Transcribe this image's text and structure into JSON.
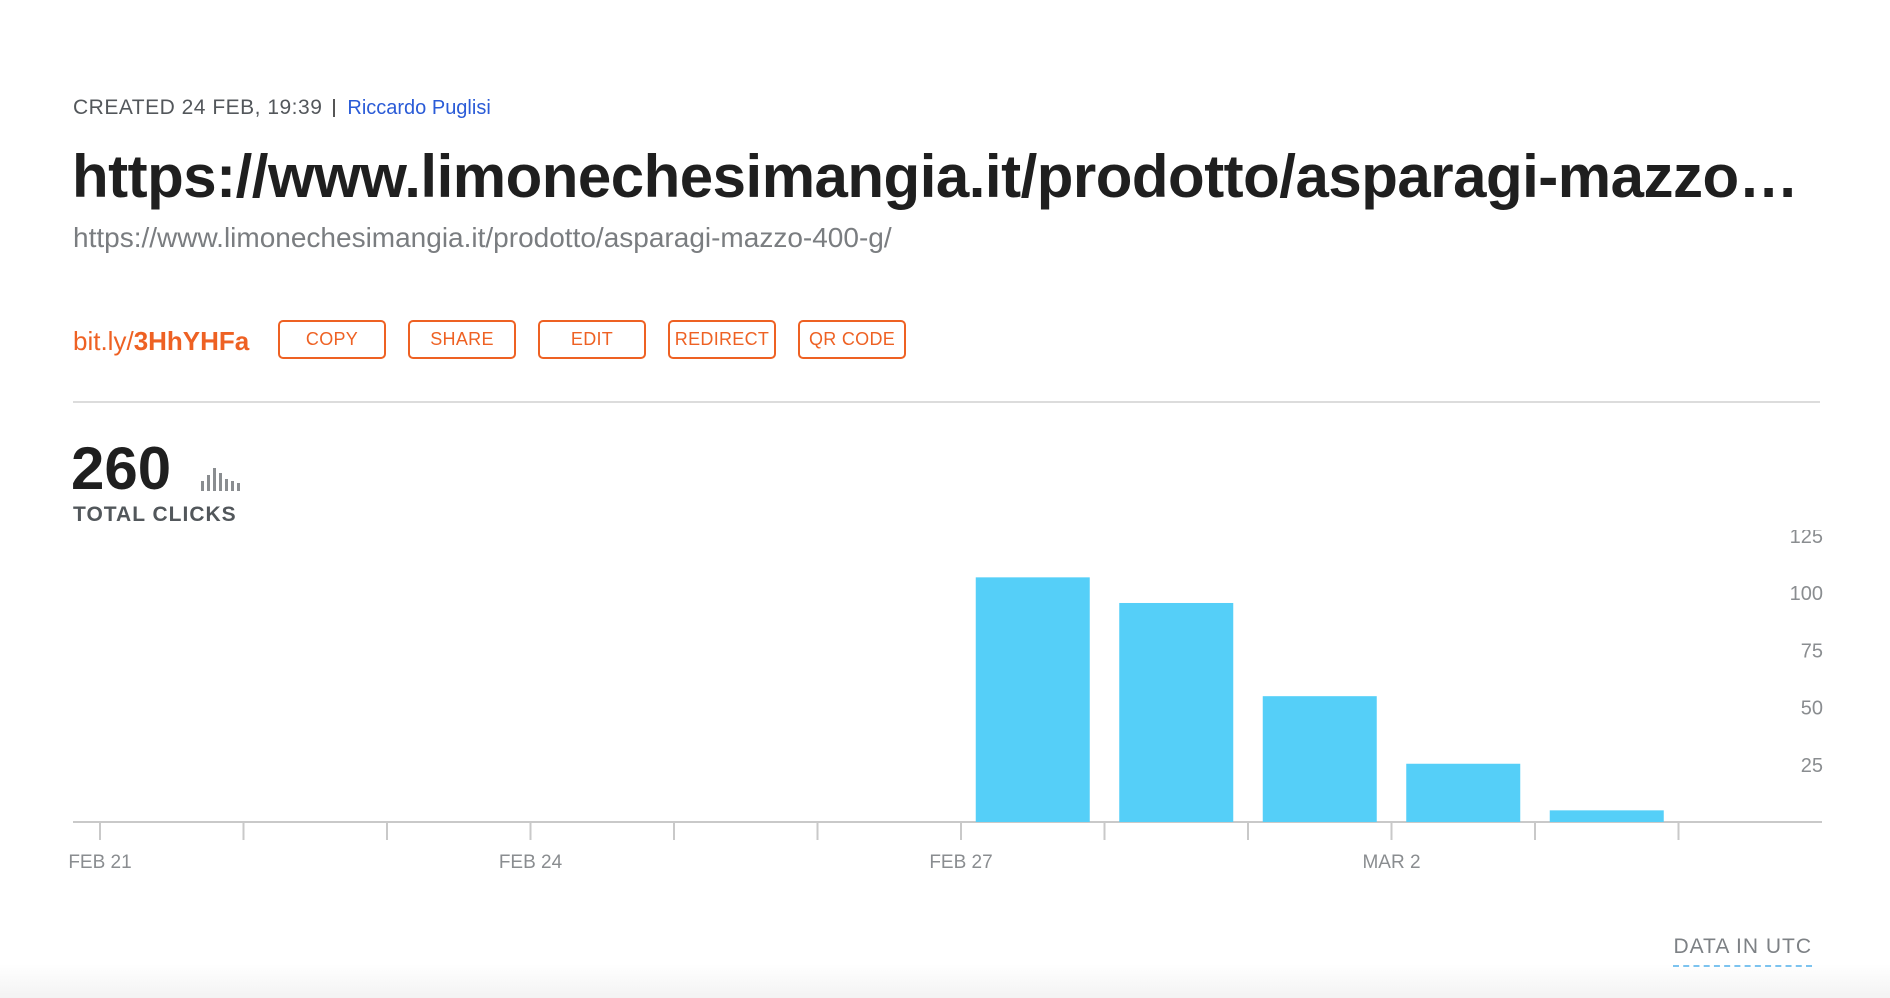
{
  "meta": {
    "created_label": "CREATED 24 FEB, 19:39",
    "author": "Riccardo Puglisi"
  },
  "link": {
    "title": "https://www.limonechesimangia.it/prodotto/asparagi-mazzo-400-g/",
    "long_url": "https://www.limonechesimangia.it/prodotto/asparagi-mazzo-400-g/",
    "short_prefix": "bit.ly/",
    "short_code": "3HhYHFa"
  },
  "actions": {
    "copy": "COPY",
    "share": "SHARE",
    "edit": "EDIT",
    "redirect": "REDIRECT",
    "qr_code": "QR CODE"
  },
  "stats": {
    "total_clicks": "260",
    "total_label": "TOTAL CLICKS",
    "timezone_note": "DATA IN UTC"
  },
  "colors": {
    "accent": "#ee6123",
    "bar": "#55cff8",
    "author_link": "#2a5bd7"
  },
  "icons": {
    "clicks_chart": "bar-chart-icon"
  },
  "chart_data": {
    "type": "bar",
    "categories": [
      "Feb 21",
      "Feb 22",
      "Feb 23",
      "Feb 24",
      "Feb 25",
      "Feb 26",
      "Feb 27",
      "Feb 28",
      "Mar 1",
      "Mar 2",
      "Mar 3",
      "Mar 4"
    ],
    "values": [
      0,
      0,
      0,
      0,
      0,
      0,
      0,
      105,
      94,
      54,
      25,
      5
    ],
    "x_tick_labels": [
      "FEB 21",
      "FEB 24",
      "FEB 27",
      "MAR 2"
    ],
    "y_ticks": [
      25,
      50,
      75,
      100,
      125
    ],
    "ylim": [
      0,
      125
    ],
    "y_axis_position": "right",
    "grid": false,
    "title": "",
    "xlabel": "",
    "ylabel": ""
  }
}
